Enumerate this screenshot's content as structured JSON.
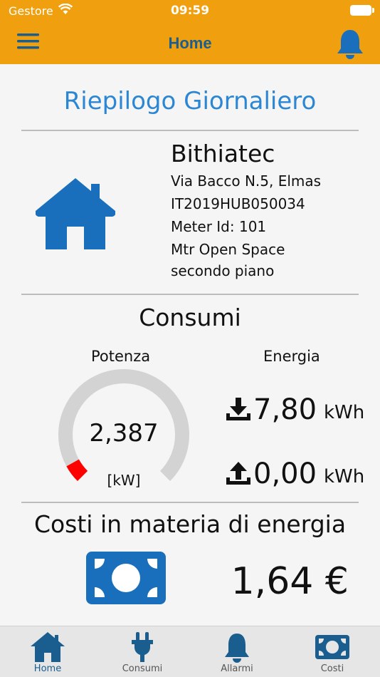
{
  "status_bar": {
    "carrier": "Gestore",
    "time": "09:59"
  },
  "navbar": {
    "title": "Home"
  },
  "summary": {
    "heading": "Riepilogo Giornaliero",
    "site": {
      "name": "Bithiatec",
      "address": "Via Bacco N.5, Elmas",
      "code": "IT2019HUB050034",
      "meter_id": "Meter Id: 101",
      "meter_desc_1": "Mtr Open Space",
      "meter_desc_2": "secondo piano"
    }
  },
  "consumption": {
    "title": "Consumi",
    "power": {
      "label": "Potenza",
      "value": "2,387",
      "unit": "[kW]",
      "gauge_fraction": 0.06
    },
    "energy": {
      "label": "Energia",
      "imported": {
        "value": "7,80",
        "unit": "kWh"
      },
      "exported": {
        "value": "0,00",
        "unit": "kWh"
      }
    }
  },
  "costs": {
    "title": "Costi in materia di energia",
    "value": "1,64 €"
  },
  "tabs": [
    {
      "label": "Home",
      "icon": "house-icon",
      "active": true
    },
    {
      "label": "Consumi",
      "icon": "plug-icon",
      "active": false
    },
    {
      "label": "Allarmi",
      "icon": "bell-icon",
      "active": false
    },
    {
      "label": "Costi",
      "icon": "money-icon",
      "active": false
    }
  ],
  "colors": {
    "brand": "#f0a00e",
    "accent": "#1a6fbd",
    "heading": "#2b86d3",
    "gauge_track": "#d3d3d3",
    "gauge_fill": "#ff0000"
  }
}
